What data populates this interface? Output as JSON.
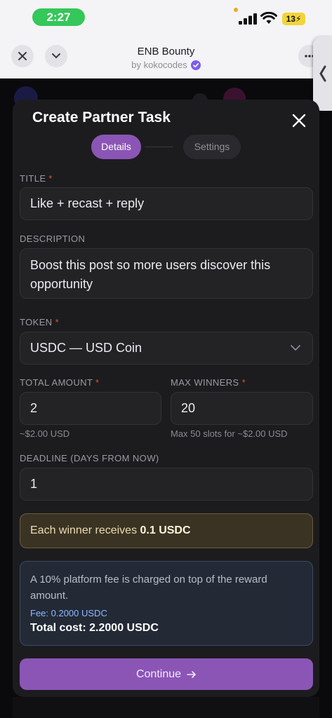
{
  "status_bar": {
    "time": "2:27",
    "battery": "13"
  },
  "header": {
    "title": "ENB Bounty",
    "subtitle": "by kokocodes"
  },
  "modal": {
    "title": "Create Partner Task",
    "steps": [
      "Details",
      "Settings"
    ],
    "title_field": {
      "label": "TITLE",
      "required": "*",
      "value": "Like + recast  + reply"
    },
    "description_field": {
      "label": "DESCRIPTION",
      "value": "Boost this post so more users discover this opportunity"
    },
    "token_field": {
      "label": "TOKEN",
      "required": "*",
      "value": "USDC — USD Coin"
    },
    "amount_field": {
      "label": "TOTAL AMOUNT",
      "required": "*",
      "value": "2",
      "hint": "~$2.00 USD"
    },
    "winners_field": {
      "label": "MAX WINNERS",
      "required": "*",
      "value": "20",
      "hint": "Max 50 slots for ~$2.00 USD"
    },
    "deadline_field": {
      "label": "DEADLINE (DAYS FROM NOW)",
      "value": "1"
    },
    "winner_info": {
      "prefix": "Each winner receives ",
      "amount": "0.1 USDC"
    },
    "fee_info": {
      "note": "A 10% platform fee is charged on top of the reward amount.",
      "fee": "Fee: 0.2000 USDC",
      "total": "Total cost: 2.2000 USDC"
    },
    "continue_label": "Continue"
  },
  "colors": {
    "accent": "#8b55b5",
    "required": "#e0503c",
    "status_green": "#34c759"
  },
  "icons": [
    "signal-icon",
    "wifi-icon",
    "close-icon",
    "chevron-down-icon",
    "more-icon",
    "verified-icon",
    "chevron-left-icon",
    "arrow-right-icon"
  ]
}
